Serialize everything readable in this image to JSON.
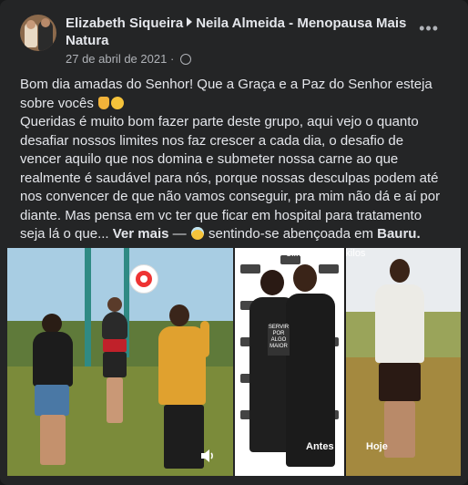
{
  "post": {
    "author": "Elizabeth Siqueira",
    "group": "Neila Almeida - Menopausa Mais Natura",
    "date": "27 de abril de 2021",
    "dot": "·",
    "more_label": "•••",
    "line1": "Bom dia amadas do Senhor! Que a Graça e a Paz  do Senhor esteja sobre vocês",
    "body": "Queridas é muito bom fazer parte deste grupo, aqui vejo o quanto desafiar nossos limites nos faz crescer a cada dia, o desafio de vencer aquilo que nos domina e submeter nossa carne ao que realmente é saudável para nós,  porque nossas desculpas podem até nos convencer de que não vamos conseguir,  pra mim não dá e aí por diante. Mas pensa em vc ter que ficar em hospital para tratamento seja lá o que...",
    "see_more": "Ver mais",
    "dash": "—",
    "feeling_prefix": "sentindo-se abençoada em",
    "location": "Bauru."
  },
  "photos": {
    "caption_top": "eliminado 10 kilos",
    "label_before": "Antes",
    "label_after": "Hoje",
    "sign_text": "SERVIR POR ALGO MAIOR"
  },
  "icons": [
    "globe-icon",
    "more-options-icon",
    "praying-hands-icon",
    "star-eyes-icon",
    "blessed-face-icon",
    "volume-icon",
    "target-icon"
  ],
  "colors": {
    "background": "#242526",
    "text": "#e4e6eb",
    "secondary": "#b0b3b8"
  }
}
